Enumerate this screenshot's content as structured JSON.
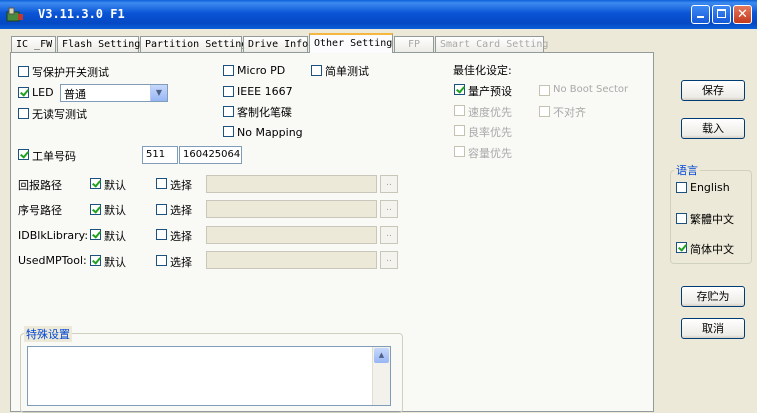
{
  "window": {
    "title": "V3.11.3.0 F1",
    "icon": "app-icon",
    "controls": [
      "minimize-icon",
      "maximize-icon",
      "close-icon"
    ]
  },
  "tabs": [
    {
      "label": "IC _FW"
    },
    {
      "label": "Flash Setting"
    },
    {
      "label": "Partition Setting"
    },
    {
      "label": "Drive Info"
    },
    {
      "label": "Other Setting"
    },
    {
      "label": "FP"
    },
    {
      "label": "Smart Card Setting"
    }
  ],
  "options": {
    "write_protect": {
      "label": "写保护开关测试",
      "checked": false
    },
    "led": {
      "label": "LED",
      "checked": true,
      "select_value": "普通"
    },
    "no_read_write_test": {
      "label": "无读写测试",
      "checked": false
    },
    "micro_pd": {
      "label": "Micro PD",
      "checked": false
    },
    "ieee_1667": {
      "label": "IEEE 1667",
      "checked": false
    },
    "custom_cdrom": {
      "label": "客制化笔碟",
      "checked": false
    },
    "no_mapping": {
      "label": "No Mapping",
      "checked": false
    },
    "simple_test": {
      "label": "简单测试",
      "checked": false
    }
  },
  "optimize": {
    "heading": "最佳化设定:",
    "mass_production_preset": {
      "label": "量产预设",
      "checked": true
    },
    "speed_priority": {
      "label": "速度优先",
      "checked": false
    },
    "yield_priority": {
      "label": "良率优先",
      "checked": false
    },
    "capacity_priority": {
      "label": "容量优先",
      "checked": false
    },
    "no_boot_sector": {
      "label": "No Boot Sector",
      "checked": false
    },
    "misaligned": {
      "label": "不对齐",
      "checked": false
    }
  },
  "work_order": {
    "label": "工单号码",
    "checked": true,
    "prefix": "511",
    "number": "160425064"
  },
  "paths": {
    "default_label": "默认",
    "select_label": "选择",
    "browse_label": "..",
    "rows": [
      {
        "label": "回报路径",
        "default": true,
        "select": false
      },
      {
        "label": "序号路径",
        "default": true,
        "select": false
      },
      {
        "label": "IDBlkLibrary:",
        "default": true,
        "select": false
      },
      {
        "label": "UsedMPTool:",
        "default": true,
        "select": false
      }
    ]
  },
  "special": {
    "title": "特殊设置"
  },
  "right_panel": {
    "save": "保存",
    "load": "载入",
    "language": {
      "title": "语言",
      "english": "English",
      "traditional": "繁體中文",
      "simplified": "简体中文",
      "selected": "简体中文"
    },
    "save_as": "存贮为",
    "cancel": "取消"
  }
}
